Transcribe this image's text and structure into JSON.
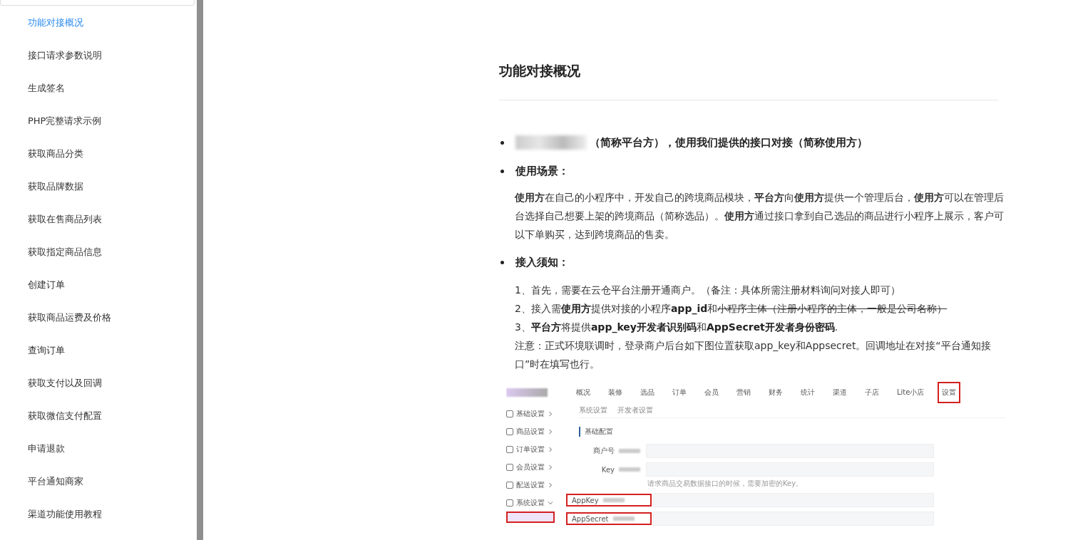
{
  "sidebar": {
    "items": [
      {
        "label": "功能对接概况",
        "selected": true
      },
      {
        "label": "接口请求参数说明",
        "selected": false
      },
      {
        "label": "生成签名",
        "selected": false
      },
      {
        "label": "PHP完整请求示例",
        "selected": false
      },
      {
        "label": "获取商品分类",
        "selected": false
      },
      {
        "label": "获取品牌数据",
        "selected": false
      },
      {
        "label": "获取在售商品列表",
        "selected": false
      },
      {
        "label": "获取指定商品信息",
        "selected": false
      },
      {
        "label": "创建订单",
        "selected": false
      },
      {
        "label": "获取商品运费及价格",
        "selected": false
      },
      {
        "label": "查询订单",
        "selected": false
      },
      {
        "label": "获取支付以及回调",
        "selected": false
      },
      {
        "label": "获取微信支付配置",
        "selected": false
      },
      {
        "label": "申请退款",
        "selected": false
      },
      {
        "label": "平台通知商家",
        "selected": false
      },
      {
        "label": "渠道功能使用教程",
        "selected": false
      }
    ]
  },
  "article": {
    "title": "功能对接概况",
    "bullets": [
      {
        "redacted": true,
        "text": "（简称平台方），使用我们提供的接口对接（简称使用方）"
      },
      {
        "redacted": false,
        "text": "使用场景：",
        "paragraphs": [
          "**使用方**在自己的小程序中，开发自己的跨境商品模块，**平台方**向**使用方**提供一个管理后台，**使用方**可以在管理后台选择自己想要上架的跨境商品（简称选品）。**使用方**通过接口拿到自己选品的商品进行小程序上展示，客户可以下单购买，达到跨境商品的售卖。"
        ]
      },
      {
        "redacted": false,
        "text": "接入须知：",
        "lines": [
          [
            {
              "text": "1、首先，需要在云仓平台注册开通商户。（备注：具体所需注册材料询问对接人即可）",
              "kind": "plain"
            }
          ],
          [
            {
              "text": "2、接入需",
              "kind": "plain"
            },
            {
              "text": "使用方",
              "kind": "bold"
            },
            {
              "text": "提供对接的小程序",
              "kind": "plain"
            },
            {
              "text": "app_id",
              "kind": "bold"
            },
            {
              "text": "和",
              "kind": "plain"
            },
            {
              "text": "小程序主体（注册小程序的主体，一般是公司名称）",
              "kind": "struck"
            }
          ],
          [
            {
              "text": "3、",
              "kind": "plain"
            },
            {
              "text": "平台方",
              "kind": "bold"
            },
            {
              "text": "将提供",
              "kind": "plain"
            },
            {
              "text": "app_key开发者识别码",
              "kind": "bold"
            },
            {
              "text": "和",
              "kind": "plain"
            },
            {
              "text": "AppSecret开发者身份密码",
              "kind": "bold"
            },
            {
              "text": ".",
              "kind": "plain"
            }
          ],
          [
            {
              "text": "注意：正式环境联调时，登录商户后台如下图位置获取app_key和Appsecret。回调地址在对接“平台通知接口”时在填写也行。",
              "kind": "plain"
            }
          ]
        ]
      }
    ],
    "screenshot": {
      "nav": [
        {
          "label": "概况",
          "highlighted": false
        },
        {
          "label": "装修",
          "highlighted": false
        },
        {
          "label": "选品",
          "highlighted": false
        },
        {
          "label": "订单",
          "highlighted": false
        },
        {
          "label": "会员",
          "highlighted": false
        },
        {
          "label": "营销",
          "highlighted": false
        },
        {
          "label": "财务",
          "highlighted": false
        },
        {
          "label": "统计",
          "highlighted": false
        },
        {
          "label": "渠道",
          "highlighted": false
        },
        {
          "label": "子店",
          "highlighted": false
        },
        {
          "label": "Lite小店",
          "highlighted": false
        },
        {
          "label": "设置",
          "highlighted": true
        }
      ],
      "menu": [
        {
          "label": "基础设置",
          "expanded": false
        },
        {
          "label": "商品设置",
          "expanded": false
        },
        {
          "label": "订单设置",
          "expanded": false
        },
        {
          "label": "会员设置",
          "expanded": false
        },
        {
          "label": "配送设置",
          "expanded": false
        },
        {
          "label": "系统设置",
          "expanded": true
        }
      ],
      "breadcrumb": [
        "系统设置",
        "开发者设置"
      ],
      "section": "基础配置",
      "fields": [
        {
          "label": "商户号",
          "highlighted": false
        },
        {
          "label": "Key",
          "highlighted": false,
          "hint": "请求商品交易数据接口的时候，需要加密的Key。"
        },
        {
          "label": "AppKey",
          "highlighted": true
        },
        {
          "label": "AppSecret",
          "highlighted": true
        }
      ]
    }
  }
}
